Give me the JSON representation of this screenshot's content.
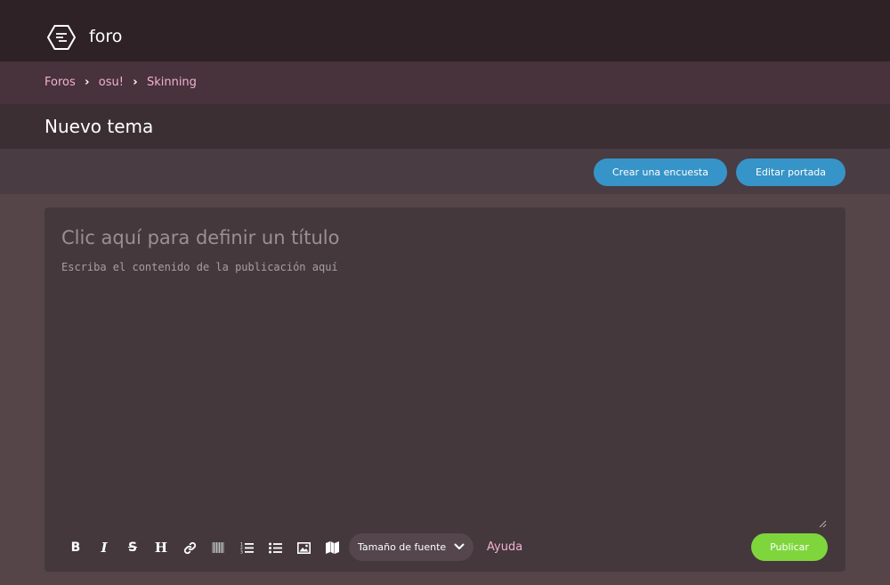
{
  "header": {
    "brand": "foro",
    "logo_icon": "forum-hexagon-icon"
  },
  "breadcrumb": [
    "Foros",
    "osu!",
    "Skinning"
  ],
  "page": {
    "title": "Nuevo tema"
  },
  "actions": {
    "create_poll": "Crear una encuesta",
    "edit_cover": "Editar portada"
  },
  "editor": {
    "title_placeholder": "Clic aquí para definir un título",
    "body_placeholder": "Escriba el contenido de la publicación aquí"
  },
  "toolbar": {
    "tools": [
      {
        "name": "bold-icon",
        "glyph": "B"
      },
      {
        "name": "italic-icon",
        "glyph": "I"
      },
      {
        "name": "strikethrough-icon",
        "glyph": "S"
      },
      {
        "name": "heading-icon",
        "glyph": "H"
      },
      {
        "name": "link-icon"
      },
      {
        "name": "spoiler-box-icon"
      },
      {
        "name": "ordered-list-icon"
      },
      {
        "name": "unordered-list-icon"
      },
      {
        "name": "image-icon"
      },
      {
        "name": "map-icon"
      }
    ],
    "font_size_label": "Tamaño de fuente",
    "help_label": "Ayuda",
    "publish_label": "Publicar"
  },
  "colors": {
    "accent_pink": "#f2b2cf",
    "button_blue": "#3794c8",
    "publish_green": "#7fd63c"
  }
}
